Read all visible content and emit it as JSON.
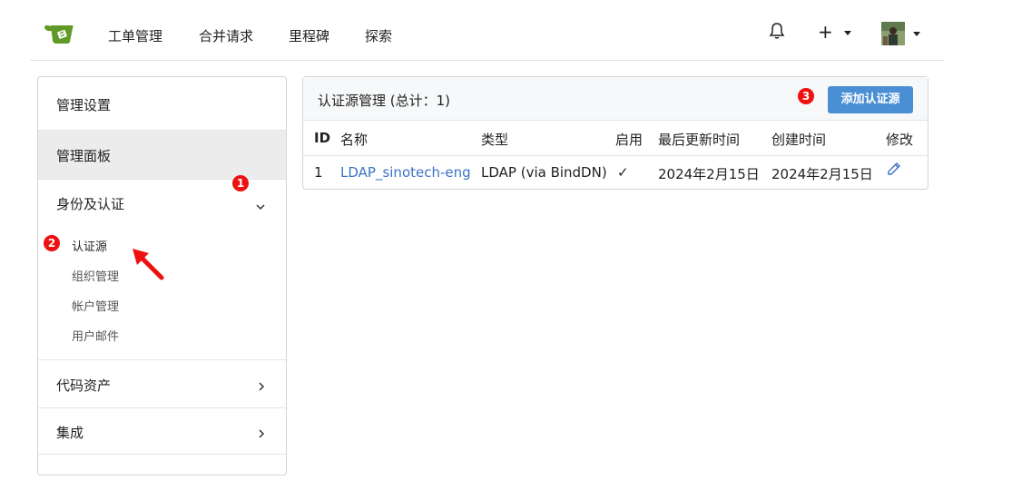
{
  "nav": {
    "links": [
      "工单管理",
      "合并请求",
      "里程碑",
      "探索"
    ],
    "plus_label": "+"
  },
  "sidebar": {
    "title": "管理设置",
    "dashboard": "管理面板",
    "identity": {
      "label": "身份及认证",
      "items": [
        "认证源",
        "组织管理",
        "帐户管理",
        "用户邮件"
      ]
    },
    "repo_assets": "代码资产",
    "integrations": "集成"
  },
  "panel": {
    "title": "认证源管理 (总计：1)",
    "add_button": "添加认证源",
    "columns": [
      "ID",
      "名称",
      "类型",
      "启用",
      "最后更新时间",
      "创建时间",
      "修改"
    ],
    "rows": [
      {
        "id": "1",
        "name": "LDAP_sinotech-eng",
        "type": "LDAP (via BindDN)",
        "enabled": "✓",
        "updated": "2024年2月15日",
        "created": "2024年2月15日",
        "edit_icon": "pencil-icon"
      }
    ]
  },
  "annotations": {
    "badge1": "1",
    "badge2": "2",
    "badge3": "3"
  },
  "colors": {
    "accent": "#4a8fd3",
    "link": "#3b73c4",
    "logo": "#609926",
    "badge": "#e11111"
  }
}
